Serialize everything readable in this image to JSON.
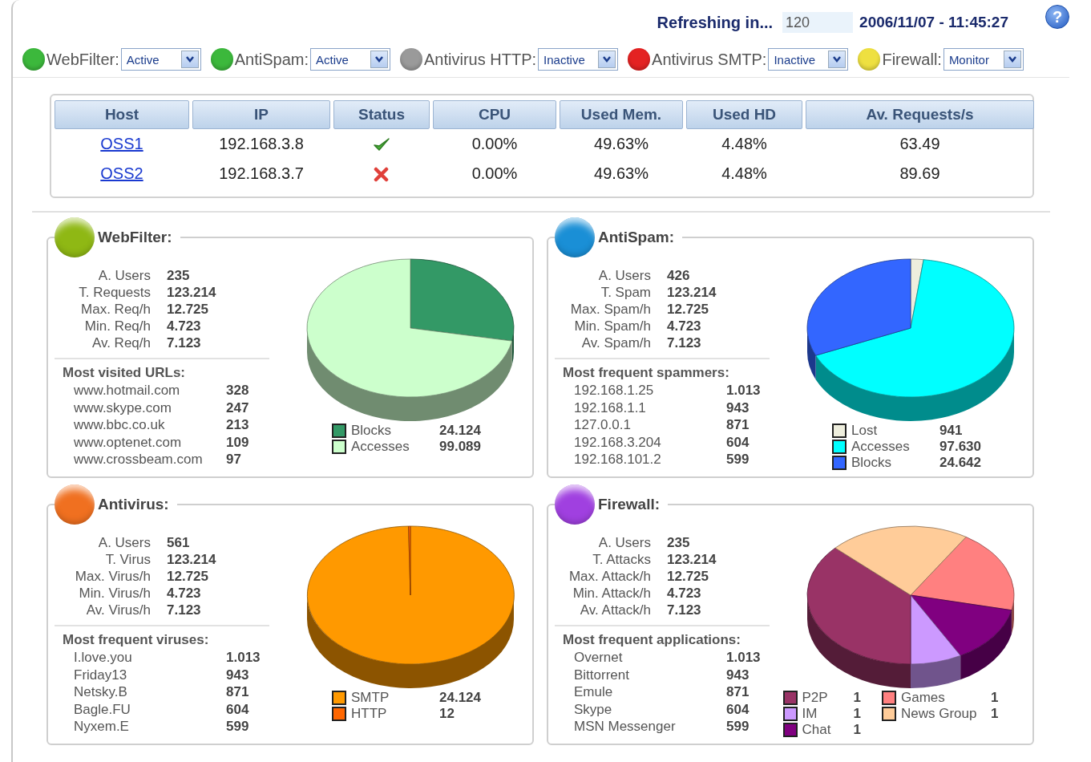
{
  "header": {
    "refresh_label": "Refreshing in...",
    "refresh_value": "120",
    "timestamp": "2006/11/07 - 11:45:27",
    "help": "?"
  },
  "modules": [
    {
      "name": "WebFilter:",
      "color": "#3cb83c",
      "mode": "Active"
    },
    {
      "name": "AntiSpam:",
      "color": "#3cb83c",
      "mode": "Active"
    },
    {
      "name": "Antivirus HTTP:",
      "color": "#9a9a9a",
      "mode": "Inactive"
    },
    {
      "name": "Antivirus SMTP:",
      "color": "#e42222",
      "mode": "Inactive"
    },
    {
      "name": "Firewall:",
      "color": "#eee040",
      "mode": "Monitor"
    }
  ],
  "hosts": {
    "columns": [
      "Host",
      "IP",
      "Status",
      "CPU",
      "Used Mem.",
      "Used HD",
      "Av. Requests/s"
    ],
    "rows": [
      {
        "host": "OSS1",
        "ip": "192.168.3.8",
        "status_ok": true,
        "cpu": "0.00%",
        "used_mem": "49.63%",
        "used_hd": "4.48%",
        "av_requests": "63.49"
      },
      {
        "host": "OSS2",
        "ip": "192.168.3.7",
        "status_ok": false,
        "cpu": "0.00%",
        "used_mem": "49.63%",
        "used_hd": "4.48%",
        "av_requests": "89.69"
      }
    ]
  },
  "panels": [
    {
      "title": "WebFilter:",
      "color": "#8fb814",
      "stats": [
        {
          "label": "A. Users",
          "value": "235"
        },
        {
          "label": "T. Requests",
          "value": "123.214"
        },
        {
          "label": "Max. Req/h",
          "value": "12.725"
        },
        {
          "label": "Min. Req/h",
          "value": "4.723"
        },
        {
          "label": "Av. Req/h",
          "value": "7.123"
        }
      ],
      "list_title": "Most visited URLs:",
      "list": [
        {
          "name": "www.hotmail.com",
          "value": "328"
        },
        {
          "name": "www.skype.com",
          "value": "247"
        },
        {
          "name": "www.bbc.co.uk",
          "value": "213"
        },
        {
          "name": "www.optenet.com",
          "value": "109"
        },
        {
          "name": "www.crossbeam.com",
          "value": "97"
        }
      ],
      "legend": [
        {
          "label": "Blocks",
          "value": "24.124",
          "color": "#339966"
        },
        {
          "label": "Accesses",
          "value": "99.089",
          "color": "#ccffcc"
        }
      ]
    },
    {
      "title": "AntiSpam:",
      "color": "#1a8fd6",
      "stats": [
        {
          "label": "A. Users",
          "value": "426"
        },
        {
          "label": "T. Spam",
          "value": "123.214"
        },
        {
          "label": "Max. Spam/h",
          "value": "12.725"
        },
        {
          "label": "Min. Spam/h",
          "value": "4.723"
        },
        {
          "label": "Av. Spam/h",
          "value": "7.123"
        }
      ],
      "list_title": "Most frequent spammers:",
      "list": [
        {
          "name": "192.168.1.25",
          "value": "1.013"
        },
        {
          "name": "192.168.1.1",
          "value": "943"
        },
        {
          "name": "127.0.0.1",
          "value": "871"
        },
        {
          "name": "192.168.3.204",
          "value": "604"
        },
        {
          "name": "192.168.101.2",
          "value": "599"
        }
      ],
      "legend": [
        {
          "label": "Lost",
          "value": "941",
          "color": "#eeeedd"
        },
        {
          "label": "Accesses",
          "value": "97.630",
          "color": "#00ffff"
        },
        {
          "label": "Blocks",
          "value": "24.642",
          "color": "#3366ff"
        }
      ]
    },
    {
      "title": "Antivirus:",
      "color": "#f07020",
      "stats": [
        {
          "label": "A. Users",
          "value": "561"
        },
        {
          "label": "T. Virus",
          "value": "123.214"
        },
        {
          "label": "Max. Virus/h",
          "value": "12.725"
        },
        {
          "label": "Min. Virus/h",
          "value": "4.723"
        },
        {
          "label": "Av. Virus/h",
          "value": "7.123"
        }
      ],
      "list_title": "Most frequent viruses:",
      "list": [
        {
          "name": "I.love.you",
          "value": "1.013"
        },
        {
          "name": "Friday13",
          "value": "943"
        },
        {
          "name": "Netsky.B",
          "value": "871"
        },
        {
          "name": "Bagle.FU",
          "value": "604"
        },
        {
          "name": "Nyxem.E",
          "value": "599"
        }
      ],
      "legend": [
        {
          "label": "SMTP",
          "value": "24.124",
          "color": "#ff9900"
        },
        {
          "label": "HTTP",
          "value": "12",
          "color": "#ff6600"
        }
      ]
    },
    {
      "title": "Firewall:",
      "color": "#a040e0",
      "stats": [
        {
          "label": "A. Users",
          "value": "235"
        },
        {
          "label": "T. Attacks",
          "value": "123.214"
        },
        {
          "label": "Max. Attack/h",
          "value": "12.725"
        },
        {
          "label": "Min. Attack/h",
          "value": "4.723"
        },
        {
          "label": "Av. Attack/h",
          "value": "7.123"
        }
      ],
      "list_title": "Most frequent applications:",
      "list": [
        {
          "name": "Overnet",
          "value": "1.013"
        },
        {
          "name": "Bittorrent",
          "value": "943"
        },
        {
          "name": "Emule",
          "value": "871"
        },
        {
          "name": "Skype",
          "value": "604"
        },
        {
          "name": "MSN Messenger",
          "value": "599"
        }
      ],
      "legend": [
        {
          "label": "P2P",
          "value": "1",
          "color": "#993366"
        },
        {
          "label": "IM",
          "value": "1",
          "color": "#cc99ff"
        },
        {
          "label": "Chat",
          "value": "1",
          "color": "#800080"
        },
        {
          "label": "Games",
          "value": "1",
          "color": "#ff8080"
        },
        {
          "label": "News Group",
          "value": "1",
          "color": "#ffcc99"
        }
      ]
    }
  ]
}
